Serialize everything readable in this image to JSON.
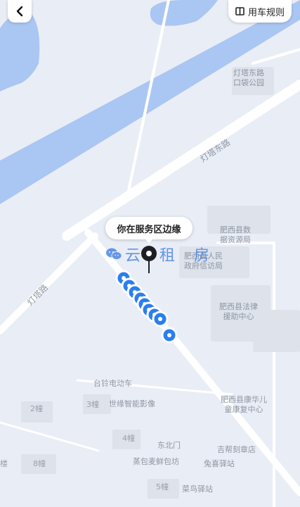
{
  "header": {
    "back_label": "back",
    "rules_label": "用车规则"
  },
  "map": {
    "bubble_text": "你在服务区边缘",
    "watermark_text": "云 租 房",
    "roads": {
      "dengta_road": "灯塔路",
      "dengta_east_road": "灯塔东路"
    },
    "pois": {
      "park": [
        "灯塔东路",
        "口袋公园"
      ],
      "data_bureau": [
        "肥西县数",
        "据资源局"
      ],
      "petition_bureau": [
        "肥西县人民",
        "政府信访局"
      ],
      "legal_aid": [
        "肥西县法律",
        "援助中心"
      ],
      "children_center": [
        "肥西县康华儿",
        "童康复中心"
      ],
      "dealer": "台铃电动车",
      "photo_studio": "世缘智能影像",
      "north_gate": "东北门",
      "stamp_shop": "吉帮刻章店",
      "bakery": "蒸包麦鲜包坊",
      "post1": "兔喜驿站",
      "post2": "菜鸟驿站"
    },
    "buildings": {
      "b2": "2幢",
      "b3": "3幢",
      "b4": "4幢",
      "b5": "5幢",
      "b8": "8幢",
      "edge": "楼"
    }
  },
  "colors": {
    "water": "#aac6f2",
    "road_main": "#ffffff",
    "land": "#e9edf5",
    "block": "#dfe3ec",
    "marker": "#2b7ef0"
  }
}
